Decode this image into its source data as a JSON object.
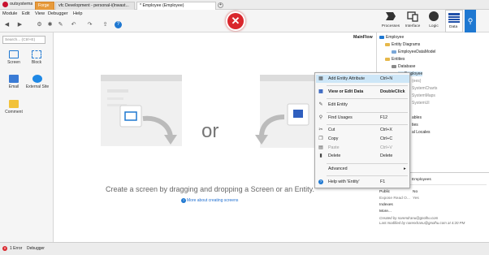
{
  "titlebar": {
    "app_name": "outsystems",
    "tabs": [
      "Forge",
      "vfc Development - personal-i(lnwast...",
      "* Employee (Employee)"
    ],
    "add_tab": "+"
  },
  "menu": [
    "Module",
    "Edit",
    "View",
    "Debugger",
    "Help"
  ],
  "topnav": {
    "processes": "Processes",
    "interface": "Interface",
    "logic": "Logic",
    "data": "Data"
  },
  "left": {
    "search_placeholder": "Search... (Ctrl+E)",
    "widgets": [
      "Screen",
      "Block",
      "Email",
      "External Site",
      "Comment"
    ]
  },
  "canvas": {
    "flow_name": "MainFlow",
    "or": "or",
    "instruction": "Create a screen by dragging and dropping a Screen or an Entity.",
    "link": "More about creating screens"
  },
  "tree": {
    "root": "Employee",
    "entity_diagrams": "Entity Diagrams",
    "diagram": "EmployeeDataModel",
    "entities": "Entities",
    "database": "Database",
    "selected": "Employee",
    "partials": [
      "(ees)",
      "SystemCharts",
      "SystemMaps",
      "SystemUI",
      "ables",
      "ties",
      "al Locales"
    ]
  },
  "properties": {
    "title_value": "Employees",
    "rows": [
      {
        "label": "Public",
        "value": "No"
      },
      {
        "label": "Expose Read O...",
        "value": "Yes"
      },
      {
        "label": "Indexes",
        "value": ""
      },
      {
        "label": "More...",
        "value": ""
      }
    ],
    "created": "Created by narendranu@gnolhu.com",
    "modified": "Last modified by narendranu@gnolhu.com at 4:20 PM"
  },
  "status": {
    "errors": "1 Error",
    "debugger": "Debugger"
  },
  "context_menu": [
    {
      "icon": "add-attribute-icon",
      "glyph": "▦",
      "label": "Add Entity Attribute",
      "shortcut": "Ctrl+N",
      "style": "hl"
    },
    {
      "icon": "table-icon",
      "glyph": "▦",
      "label": "View or Edit Data",
      "shortcut": "DoubleClick",
      "style": "bold"
    },
    {
      "icon": "pencil-icon",
      "glyph": "✎",
      "label": "Edit Entity",
      "shortcut": "",
      "style": ""
    },
    {
      "icon": "magnifier-icon",
      "glyph": "⚲",
      "label": "Find Usages",
      "shortcut": "F12",
      "style": ""
    },
    {
      "icon": "scissors-icon",
      "glyph": "✂",
      "label": "Cut",
      "shortcut": "Ctrl+X",
      "style": ""
    },
    {
      "icon": "copy-icon",
      "glyph": "❐",
      "label": "Copy",
      "shortcut": "Ctrl+C",
      "style": ""
    },
    {
      "icon": "paste-icon",
      "glyph": "▤",
      "label": "Paste",
      "shortcut": "Ctrl+V",
      "style": "dim"
    },
    {
      "icon": "trash-icon",
      "glyph": "▮",
      "label": "Delete",
      "shortcut": "Delete",
      "style": ""
    },
    {
      "icon": "",
      "glyph": "",
      "label": "Advanced",
      "shortcut": "▸",
      "style": ""
    },
    {
      "icon": "help-icon",
      "glyph": "?",
      "label": "Help with 'Entity'",
      "shortcut": "F1",
      "style": ""
    }
  ],
  "colors": {
    "accent": "#1f78d1",
    "error": "#d9262c",
    "forge_tab": "#e79a3b",
    "highlight": "#cde6f7"
  }
}
